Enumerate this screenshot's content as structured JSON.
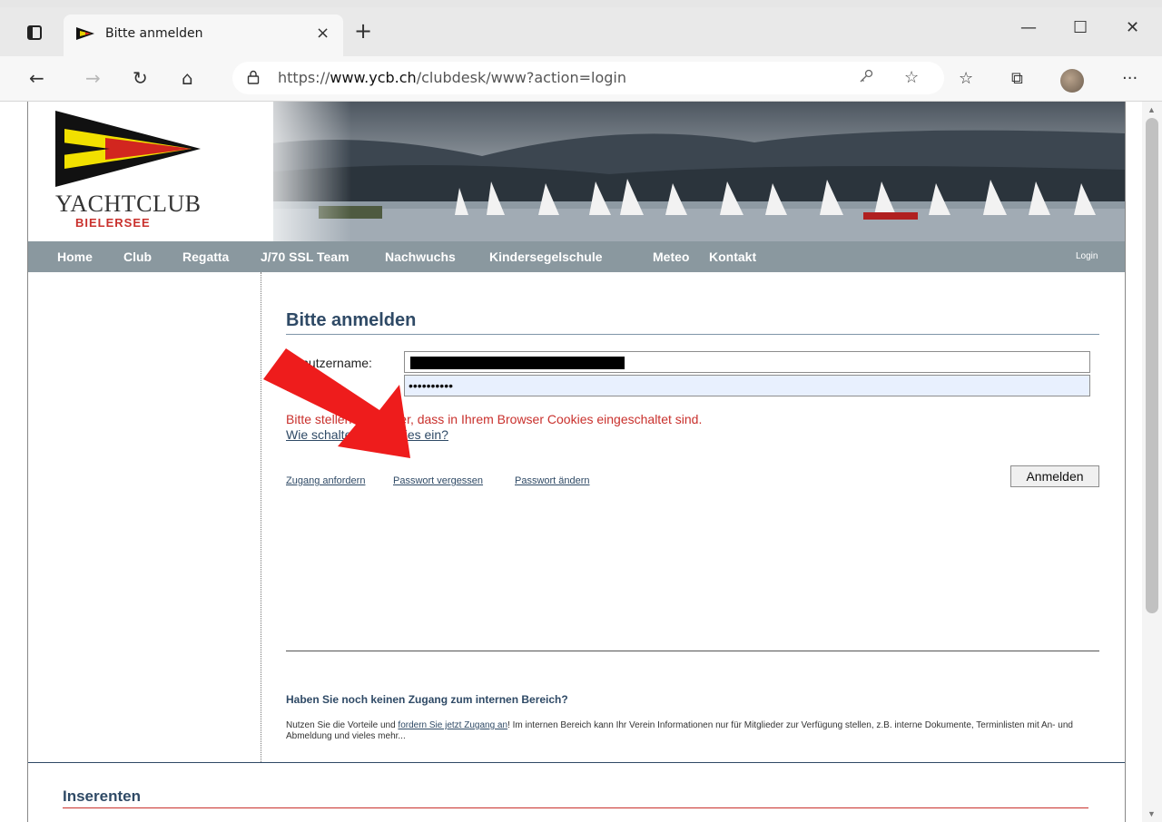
{
  "browser": {
    "tab_title": "Bitte anmelden",
    "tab_close": "×",
    "new_tab": "+",
    "window_controls": {
      "minimize": "—",
      "maximize": "☐",
      "close": "✕"
    },
    "nav": {
      "back": "←",
      "forward": "→",
      "refresh": "↻",
      "home": "⌂"
    },
    "url_prefix": "https://",
    "url_host": "www.ycb.ch",
    "url_path": "/clubdesk/www?action=login",
    "toolbar_icons": [
      "key-icon",
      "add-favorite-icon",
      "favorites-icon",
      "collections-icon",
      "profile-avatar",
      "more-icon"
    ],
    "more": "···"
  },
  "site": {
    "logo_text": "YACHTCLUB",
    "logo_sub": "BIELERSEE",
    "nav_items": [
      "Home",
      "Club",
      "Regatta",
      "J/70 SSL Team",
      "Nachwuchs",
      "Kindersegelschule",
      "Meteo",
      "Kontakt"
    ],
    "login_link": "Login"
  },
  "login": {
    "title": "Bitte anmelden",
    "username_label": "Benutzername:",
    "password_label": "Passwort:",
    "password_value": "••••••••••",
    "cookie_warning": "Bitte stellen Sie sicher, dass in Ihrem Browser Cookies eingeschaltet sind.",
    "cookie_help": "Wie schalte ich Cookies ein?",
    "links": [
      "Zugang anfordern",
      "Passwort vergessen",
      "Passwort ändern"
    ],
    "submit": "Anmelden"
  },
  "info": {
    "title": "Haben Sie noch keinen Zugang zum internen Bereich?",
    "text_before": "Nutzen Sie die Vorteile und ",
    "text_link": "fordern Sie jetzt Zugang an",
    "text_after": "! Im internen Bereich kann Ihr Verein Informationen nur für Mitglieder zur Verfügung stellen, z.B. interne Dokumente, Terminlisten mit An- und Abmeldung und vieles mehr..."
  },
  "footer": {
    "inserenten": "Inserenten"
  },
  "colors": {
    "accent_blue": "#2f4a66",
    "warning_red": "#c9302c",
    "nav_gray": "#8a989f",
    "arrow_red": "#ee1c1c"
  }
}
